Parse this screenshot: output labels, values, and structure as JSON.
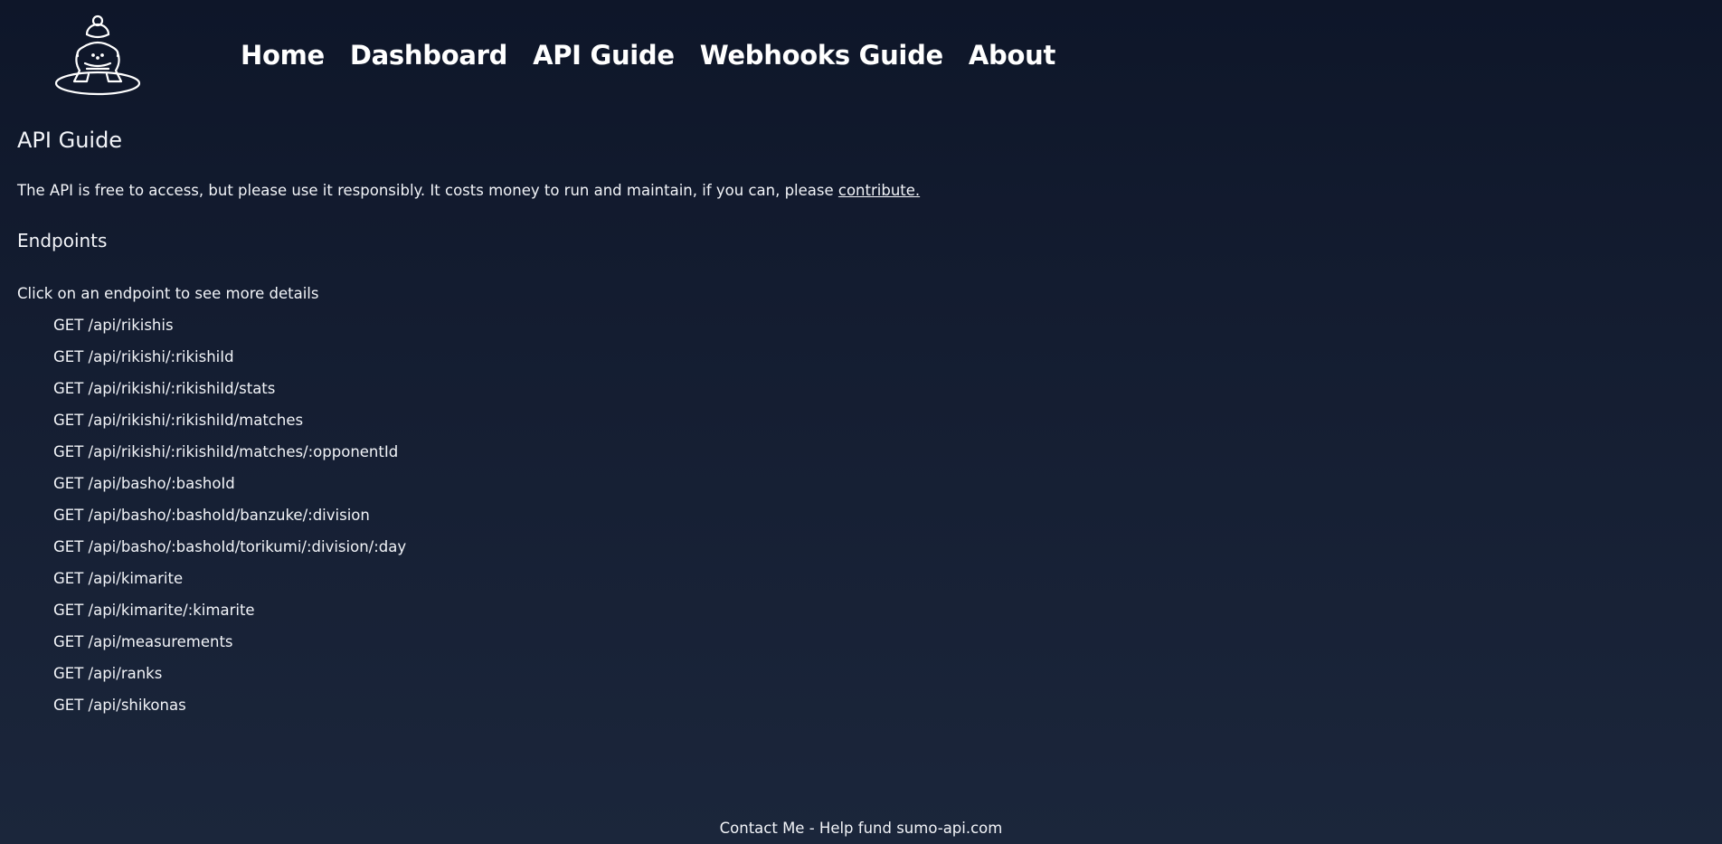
{
  "nav": {
    "items": [
      "Home",
      "Dashboard",
      "API Guide",
      "Webhooks Guide",
      "About"
    ]
  },
  "page": {
    "title": "API Guide",
    "intro_text": "The API is free to access, but please use it responsibly. It costs money to run and maintain, if you can, please ",
    "contribute_link": "contribute.",
    "endpoints_heading": "Endpoints",
    "endpoints_hint": "Click on an endpoint to see more details",
    "endpoints": [
      "GET /api/rikishis",
      "GET /api/rikishi/:rikishiId",
      "GET /api/rikishi/:rikishiId/stats",
      "GET /api/rikishi/:rikishiId/matches",
      "GET /api/rikishi/:rikishiId/matches/:opponentId",
      "GET /api/basho/:bashoId",
      "GET /api/basho/:bashoId/banzuke/:division",
      "GET /api/basho/:bashoId/torikumi/:division/:day",
      "GET /api/kimarite",
      "GET /api/kimarite/:kimarite",
      "GET /api/measurements",
      "GET /api/ranks",
      "GET /api/shikonas"
    ]
  },
  "footer": {
    "contact": "Contact Me",
    "separator": " - ",
    "fund": "Help fund sumo-api.com"
  },
  "icons": {
    "logo": "sumo-wrestler-icon"
  },
  "colors": {
    "background_top": "#0e1629",
    "background_bottom": "#1b263b",
    "text": "#f2f4f8"
  }
}
